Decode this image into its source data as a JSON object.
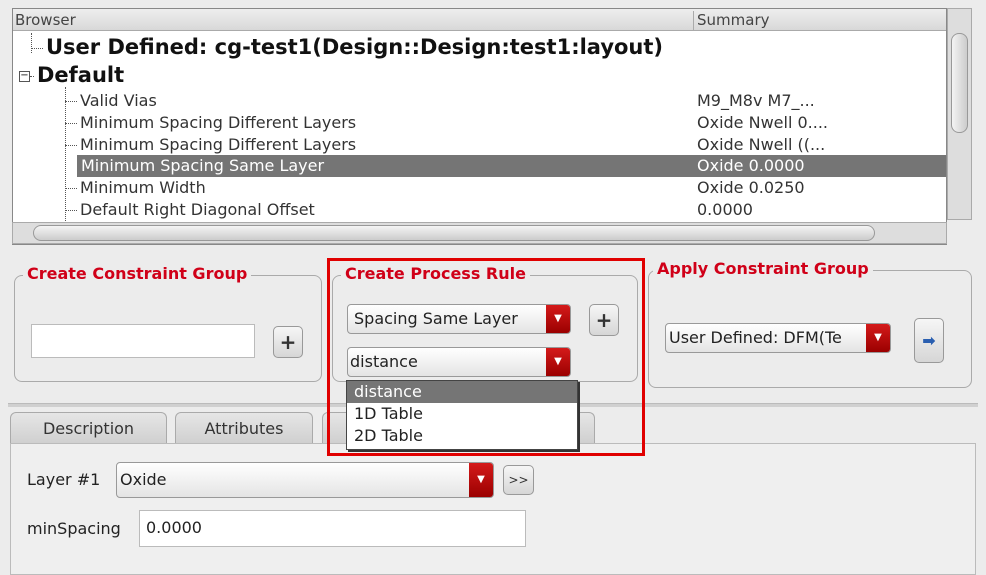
{
  "browser": {
    "col_browser": "Browser",
    "col_summary": "Summary",
    "root_user": "User Defined: cg-test1(Design::Design:test1:layout)",
    "root_default": "Default",
    "items": [
      {
        "label": "Valid Vias",
        "summary": "M9_M8v M7_..."
      },
      {
        "label": "Minimum Spacing Different Layers",
        "summary": "Oxide Nwell 0...."
      },
      {
        "label": "Minimum Spacing Different Layers",
        "summary": "Oxide Nwell ((..."
      },
      {
        "label": "Minimum Spacing Same Layer",
        "summary": "Oxide 0.0000",
        "selected": true
      },
      {
        "label": "Minimum Width",
        "summary": "Oxide 0.0250"
      },
      {
        "label": "Default Right Diagonal Offset",
        "summary": "0.0000"
      }
    ]
  },
  "create_group": {
    "title": "Create Constraint Group",
    "name_value": "",
    "add": "+"
  },
  "process_rule": {
    "title": "Create Process Rule",
    "rule_type": "Spacing Same Layer",
    "add": "+",
    "subtype": "distance",
    "options": [
      "distance",
      "1D Table",
      "2D Table"
    ]
  },
  "apply_group": {
    "title": "Apply Constraint Group",
    "value": "User Defined: DFM(Te"
  },
  "tabs": [
    "Description",
    "Attributes",
    ""
  ],
  "form": {
    "layer_label": "Layer #1",
    "layer_value": "Oxide",
    "more": ">>",
    "min_label": "minSpacing",
    "min_value": "0.0000"
  },
  "accent": "#d00018"
}
